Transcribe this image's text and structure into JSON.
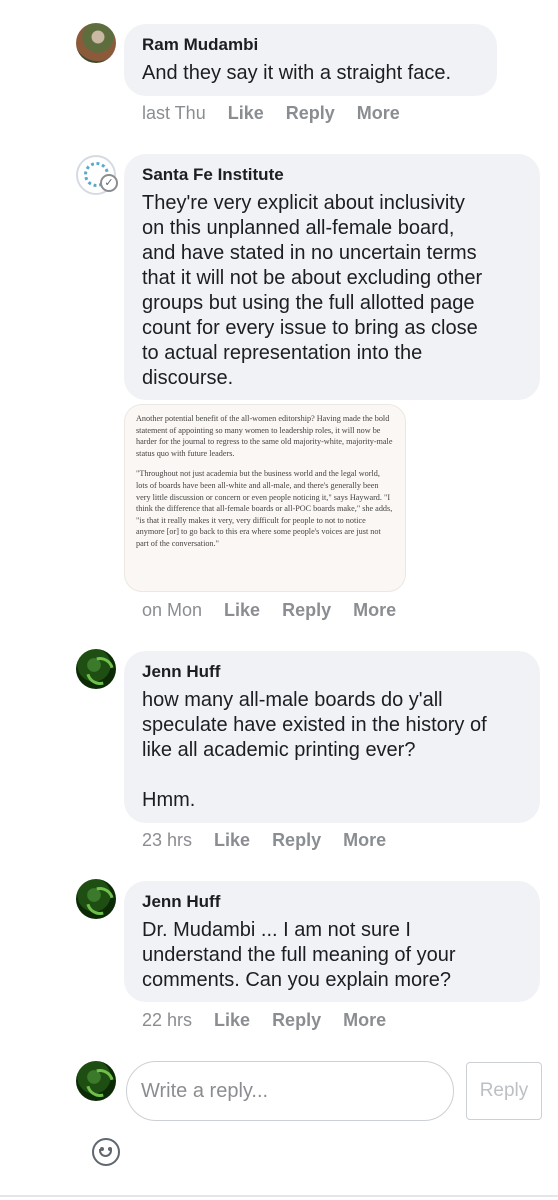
{
  "comments": [
    {
      "author": "Ram Mudambi",
      "text": "And they say it with a straight face.",
      "time": "last Thu",
      "actions": [
        "Like",
        "Reply",
        "More"
      ]
    },
    {
      "author": "Santa Fe Institute",
      "text": "They're very explicit about inclusivity\non this unplanned all-female board,\nand have stated in no uncertain terms\nthat it will not be about excluding other\ngroups but using the full allotted page\ncount for every issue to bring as close\nto actual representation into the\ndiscourse.",
      "attachment": {
        "p1": "Another potential benefit of the all-women editorship? Having made the bold statement of appointing so many women to leadership roles, it will now be harder for the journal to regress to the same old majority-white, majority-male status quo with future leaders.",
        "p2": "\"Throughout not just academia but the business world and the legal world, lots of boards have been all-white and all-male, and there's generally been very little discussion or concern or even people noticing it,\" says Hayward. \"I think the difference that all-female boards or all-POC boards make,\" she adds, \"is that it really makes it very, very difficult for people to not to notice anymore [or] to go back to this era where some people's voices are just not part of the conversation.\""
      },
      "time": "on Mon",
      "actions": [
        "Like",
        "Reply",
        "More"
      ]
    },
    {
      "author": "Jenn Huff",
      "text": "how many all-male boards do y'all\nspeculate have existed in the history of\nlike all academic printing ever?\n\nHmm.",
      "time": "23 hrs",
      "actions": [
        "Like",
        "Reply",
        "More"
      ]
    },
    {
      "author": "Jenn Huff",
      "text": "Dr. Mudambi ... I am not sure I\nunderstand the full meaning of your\ncomments. Can you explain more?",
      "time": "22 hrs",
      "actions": [
        "Like",
        "Reply",
        "More"
      ]
    }
  ],
  "composer": {
    "placeholder": "Write a reply...",
    "button_label": "Reply"
  }
}
